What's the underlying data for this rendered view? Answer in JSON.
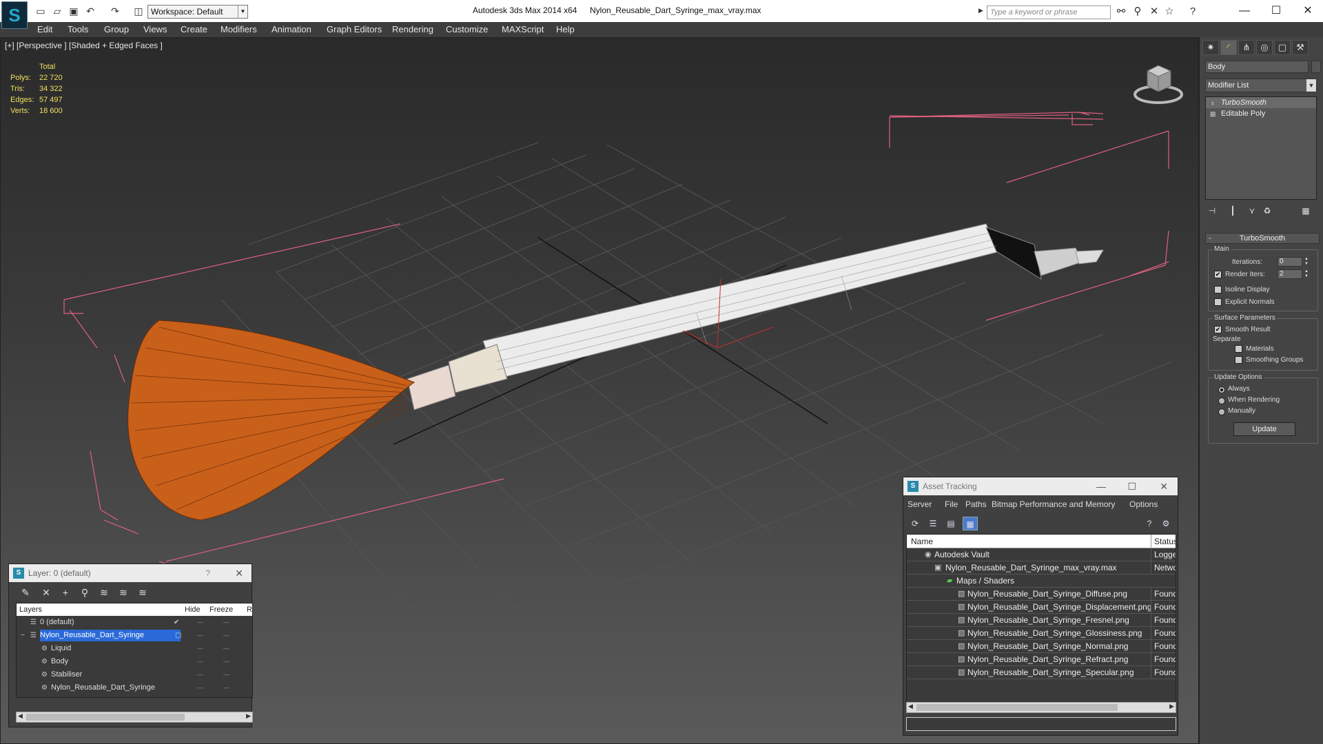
{
  "titlebar": {
    "workspace": "Workspace: Default",
    "app_title": "Autodesk 3ds Max  2014 x64",
    "file_title": "Nylon_Reusable_Dart_Syringe_max_vray.max",
    "search_placeholder": "Type a keyword or phrase"
  },
  "menu": [
    "Edit",
    "Tools",
    "Group",
    "Views",
    "Create",
    "Modifiers",
    "Animation",
    "Graph Editors",
    "Rendering",
    "Customize",
    "MAXScript",
    "Help"
  ],
  "viewport": {
    "label": "[+] [Perspective ] [Shaded + Edged Faces ]",
    "stats": {
      "header": "Total",
      "rows": [
        {
          "label": "Polys:",
          "value": "22 720"
        },
        {
          "label": "Tris:",
          "value": "34 322"
        },
        {
          "label": "Edges:",
          "value": "57 497"
        },
        {
          "label": "Verts:",
          "value": "18 600"
        }
      ]
    }
  },
  "command_panel": {
    "object_name": "Body",
    "modifier_list": "Modifier List",
    "stack": [
      "TurboSmooth",
      "Editable Poly"
    ],
    "rollout_title": "TurboSmooth",
    "main": {
      "title": "Main",
      "iterations_label": "Iterations:",
      "iterations_value": "0",
      "render_iters_label": "Render Iters:",
      "render_iters_value": "2",
      "isoline_label": "Isoline Display",
      "explicit_label": "Explicit Normals"
    },
    "surface": {
      "title": "Surface Parameters",
      "smooth_result": "Smooth Result",
      "separate": "Separate",
      "materials": "Materials",
      "smoothing_groups": "Smoothing Groups"
    },
    "update": {
      "title": "Update Options",
      "always": "Always",
      "when_rendering": "When Rendering",
      "manually": "Manually",
      "button": "Update"
    }
  },
  "layer_panel": {
    "title": "Layer: 0 (default)",
    "columns": [
      "Layers",
      "Hide",
      "Freeze",
      "R"
    ],
    "rows": [
      {
        "name": "0 (default)",
        "indent": 0,
        "selected": false
      },
      {
        "name": "Nylon_Reusable_Dart_Syringe",
        "indent": 0,
        "selected": true
      },
      {
        "name": "Liquid",
        "indent": 1,
        "selected": false
      },
      {
        "name": "Body",
        "indent": 1,
        "selected": false
      },
      {
        "name": "Stabiliser",
        "indent": 1,
        "selected": false
      },
      {
        "name": "Nylon_Reusable_Dart_Syringe",
        "indent": 1,
        "selected": false
      }
    ]
  },
  "asset_panel": {
    "title": "Asset Tracking",
    "menu": [
      "Server",
      "File",
      "Paths",
      "Bitmap Performance and Memory",
      "Options"
    ],
    "columns": [
      "Name",
      "Status"
    ],
    "rows": [
      {
        "name": "Autodesk Vault",
        "status": "Logged",
        "indent": 0
      },
      {
        "name": "Nylon_Reusable_Dart_Syringe_max_vray.max",
        "status": "Networ",
        "indent": 1
      },
      {
        "name": "Maps / Shaders",
        "status": "",
        "indent": 2
      },
      {
        "name": "Nylon_Reusable_Dart_Syringe_Diffuse.png",
        "status": "Found",
        "indent": 3
      },
      {
        "name": "Nylon_Reusable_Dart_Syringe_Displacement.png",
        "status": "Found",
        "indent": 3
      },
      {
        "name": "Nylon_Reusable_Dart_Syringe_Fresnel.png",
        "status": "Found",
        "indent": 3
      },
      {
        "name": "Nylon_Reusable_Dart_Syringe_Glossiness.png",
        "status": "Found",
        "indent": 3
      },
      {
        "name": "Nylon_Reusable_Dart_Syringe_Normal.png",
        "status": "Found",
        "indent": 3
      },
      {
        "name": "Nylon_Reusable_Dart_Syringe_Refract.png",
        "status": "Found",
        "indent": 3
      },
      {
        "name": "Nylon_Reusable_Dart_Syringe_Specular.png",
        "status": "Found",
        "indent": 3
      }
    ]
  },
  "colors": {
    "bristles": "#c8601a",
    "bounding_box": "#e06080",
    "stats_text": "#f0e060",
    "selection": "#2a6ad8"
  }
}
